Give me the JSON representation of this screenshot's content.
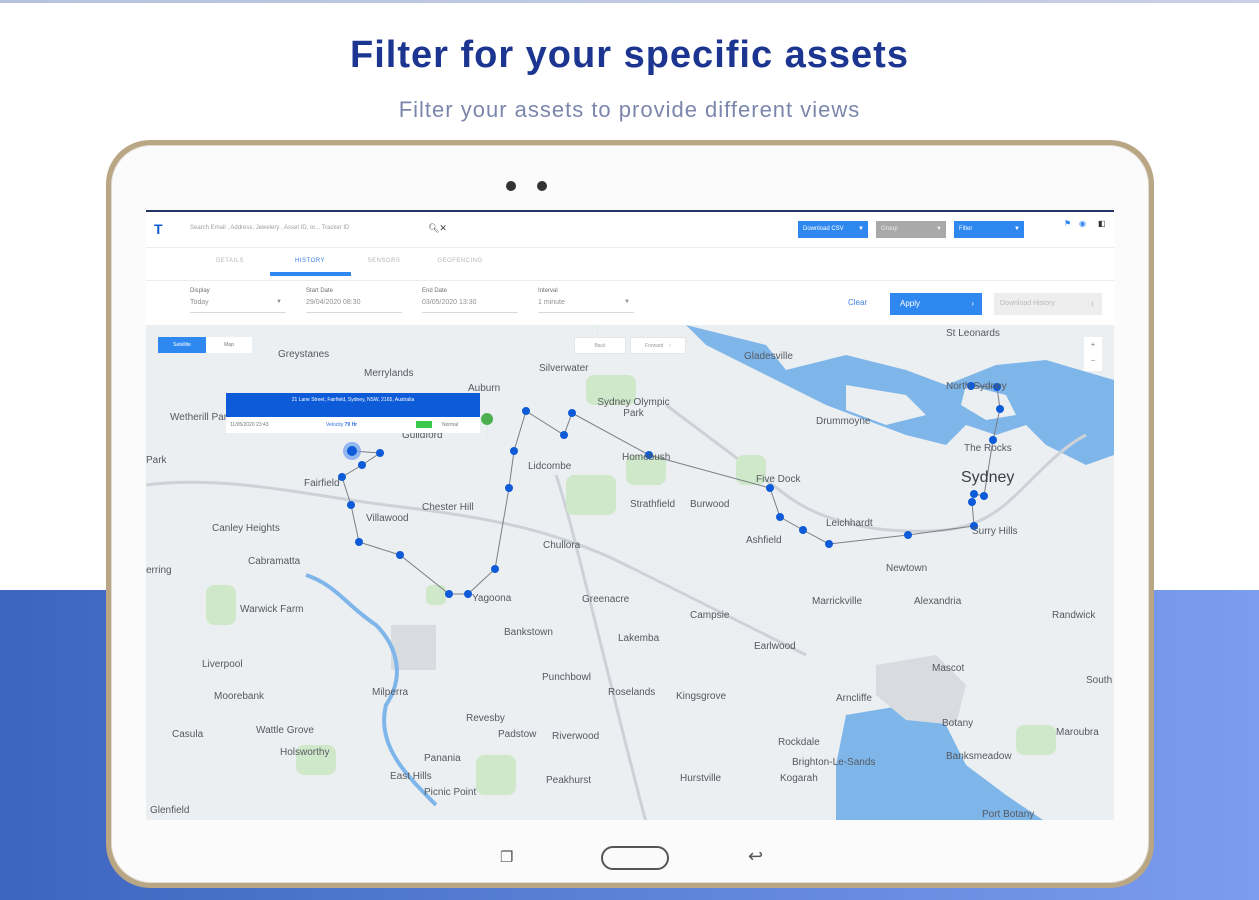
{
  "headline": "Filter for your specific assets",
  "subline": "Filter your assets to provide different views",
  "app": {
    "search_placeholder": "Search Email , Address, Jewelery , Asset ID, or... Tracker ID",
    "download_csv": "Download CSV",
    "group_select": "Group",
    "filter_select": "Filter",
    "tabs": [
      "DETAILS",
      "HISTORY",
      "SENSORS",
      "GEOFENCING"
    ],
    "active_tab": "HISTORY",
    "filters": {
      "display_label": "Display",
      "display_value": "Today",
      "start_label": "Start Date",
      "start_value": "29/04/2020 08:30",
      "end_label": "End Date",
      "end_value": "03/05/2020 13:30",
      "interval_label": "Interval",
      "interval_value": "1 minute",
      "clear": "Clear",
      "apply": "Apply",
      "download_history": "Download History"
    },
    "map": {
      "satellite": "Satellite",
      "map": "Map",
      "back": "Back",
      "forward": "Forward",
      "zoom_in": "+",
      "zoom_out": "−",
      "popup": {
        "address": "21 Lane Street, Fairfield, Sydney, NSW, 2165, Australia",
        "date": "11/05/2020 23:43",
        "velocity_label": "Velocity",
        "velocity_value": "79 Hr",
        "status": "Normal"
      },
      "labels": {
        "greystanes": "Greystanes",
        "merrylands": "Merrylands",
        "silverwater": "Silverwater",
        "gladesville": "Gladesville",
        "st_leonards": "St Leonards",
        "wetherill_park": "Wetherill Park",
        "auburn": "Auburn",
        "sydney_olympic_park": "Sydney Olympic Park",
        "drummoyne": "Drummoyne",
        "north_sydney": "North Sydney",
        "park": "Park",
        "guildford": "Guildford",
        "homebush": "Homebush",
        "the_rocks": "The Rocks",
        "lidcombe": "Lidcombe",
        "fairfield": "Fairfield",
        "five_dock": "Five Dock",
        "sydney": "Sydney",
        "chester_hill": "Chester Hill",
        "strathfield": "Strathfield",
        "burwood": "Burwood",
        "villawood": "Villawood",
        "leichhardt": "Leichhardt",
        "canley_heights": "Canley Heights",
        "ashfield": "Ashfield",
        "surry_hills": "Surry Hills",
        "chullora": "Chullora",
        "cabramatta": "Cabramatta",
        "newtown": "Newtown",
        "erring": "erring",
        "yagoona": "Yagoona",
        "greenacre": "Greenacre",
        "alexandria": "Alexandria",
        "marrickville": "Marrickville",
        "warwick_farm": "Warwick Farm",
        "campsie": "Campsie",
        "randwick": "Randwick",
        "bankstown": "Bankstown",
        "lakemba": "Lakemba",
        "earlwood": "Earlwood",
        "liverpool": "Liverpool",
        "mascot": "Mascot",
        "punchbowl": "Punchbowl",
        "south": "South",
        "roselands": "Roselands",
        "milperra": "Milperra",
        "moorebank": "Moorebank",
        "kingsgrove": "Kingsgrove",
        "arncliffe": "Arncliffe",
        "revesby": "Revesby",
        "wattle_grove": "Wattle Grove",
        "botany": "Botany",
        "casula": "Casula",
        "padstow": "Padstow",
        "riverwood": "Riverwood",
        "maroubra": "Maroubra",
        "holsworthy": "Holsworthy",
        "rockdale": "Rockdale",
        "panania": "Panania",
        "banksmeadow": "Banksmeadow",
        "brighton_le_sands": "Brighton-Le-Sands",
        "east_hills": "East Hills",
        "peakhurst": "Peakhurst",
        "hurstville": "Hurstville",
        "kogarah": "Kogarah",
        "picnic_point": "Picnic Point",
        "glenfield": "Glenfield",
        "port_botany": "Port Botany"
      }
    }
  }
}
